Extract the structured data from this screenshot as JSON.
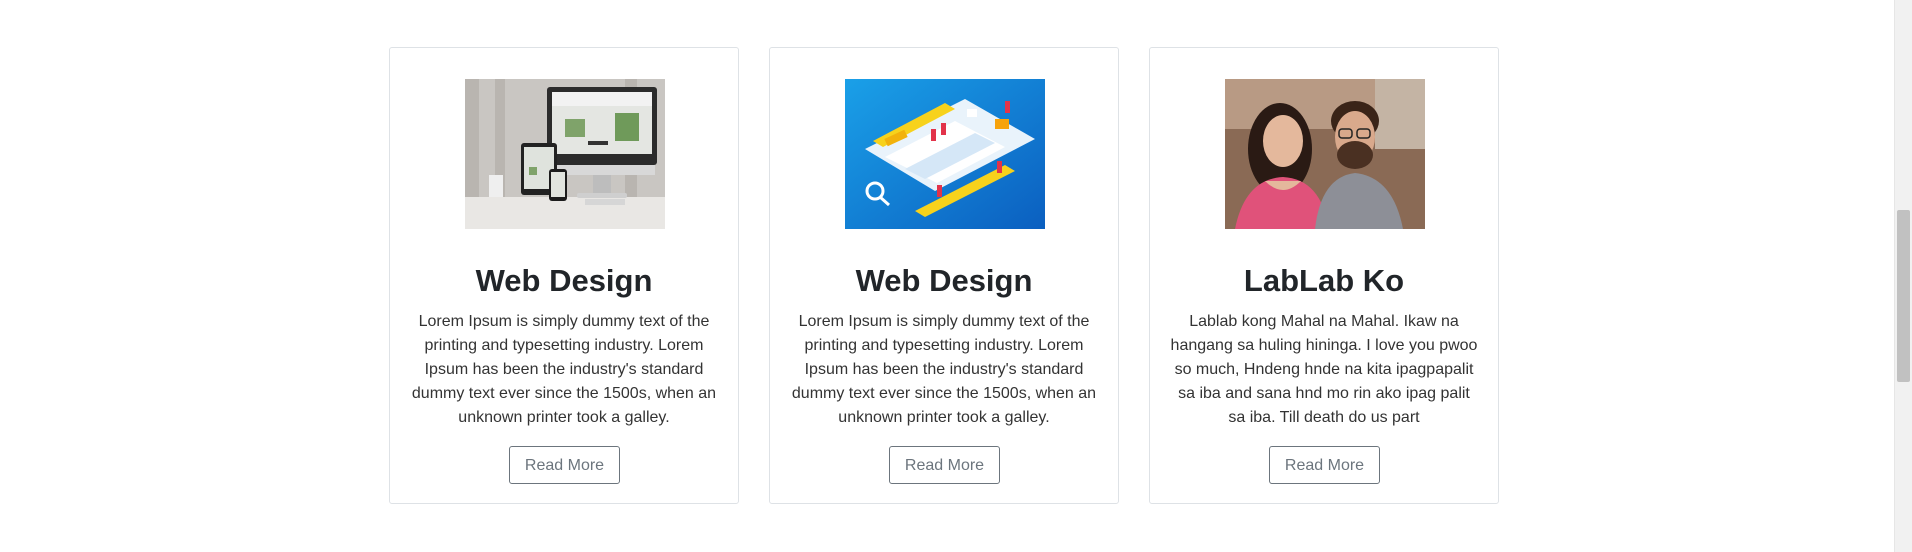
{
  "cards": [
    {
      "image": "responsive-devices-image",
      "title": "Web Design",
      "text": "Lorem Ipsum is simply dummy text of the printing and typesetting industry. Lorem Ipsum has been the industry's standard dummy text ever since the 1500s, when an unknown printer took a galley.",
      "button": "Read More"
    },
    {
      "image": "isometric-web-design-image",
      "title": "Web Design",
      "text": "Lorem Ipsum is simply dummy text of the printing and typesetting industry. Lorem Ipsum has been the industry's standard dummy text ever since the 1500s, when an unknown printer took a galley.",
      "button": "Read More"
    },
    {
      "image": "couple-photo-image",
      "title": "LabLab Ko",
      "text": "Lablab kong Mahal na Mahal. Ikaw na hangang sa huling hininga. I love you pwoo so much, Hndeng hnde na kita ipagpapalit sa iba and sana hnd mo rin ako ipag palit sa iba. Till death do us part",
      "button": "Read More"
    }
  ],
  "colors": {
    "border": "#dee2e6",
    "button_border": "#6c757d",
    "text": "#212529"
  }
}
